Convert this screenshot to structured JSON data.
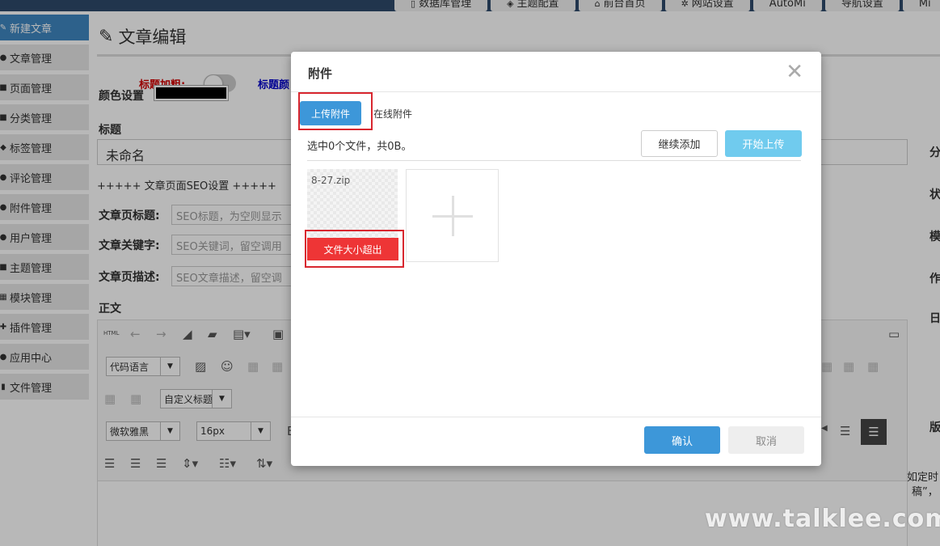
{
  "topnav": [
    {
      "label": "数据库管理",
      "icon": "database-icon"
    },
    {
      "label": "主题配置",
      "icon": "layers-icon"
    },
    {
      "label": "前台首页",
      "icon": "home-icon"
    },
    {
      "label": "网站设置",
      "icon": "gear-icon"
    },
    {
      "label": "AutoMi",
      "icon": ""
    },
    {
      "label": "导航设置",
      "icon": ""
    },
    {
      "label": "Mi",
      "icon": ""
    }
  ],
  "sidebar": {
    "items": [
      {
        "label": "新建文章",
        "icon": "edit-icon",
        "active": true
      },
      {
        "label": "文章管理",
        "icon": "list-icon"
      },
      {
        "label": "页面管理",
        "icon": "page-icon"
      },
      {
        "label": "分类管理",
        "icon": "folder-icon"
      },
      {
        "label": "标签管理",
        "icon": "tag-icon"
      },
      {
        "label": "评论管理",
        "icon": "comment-icon"
      },
      {
        "label": "附件管理",
        "icon": "attachment-icon"
      },
      {
        "label": "用户管理",
        "icon": "user-icon"
      },
      {
        "label": "主题管理",
        "icon": "theme-icon"
      },
      {
        "label": "模块管理",
        "icon": "module-icon"
      },
      {
        "label": "插件管理",
        "icon": "plugin-icon"
      },
      {
        "label": "应用中心",
        "icon": "app-icon"
      },
      {
        "label": "文件管理",
        "icon": "file-icon"
      }
    ]
  },
  "editor_page": {
    "title": "文章编辑",
    "title_bold_label": "标题加粗:",
    "title_color_label": "标题颜",
    "color_setting_label": "颜色设置",
    "title_label": "标题",
    "title_value": "未命名",
    "seo_header": "+++++ 文章页面SEO设置 +++++",
    "seo_title_label": "文章页标题:",
    "seo_title_placeholder": "SEO标题，为空则显示",
    "seo_keywords_label": "文章关键字:",
    "seo_keywords_placeholder": "SEO关键词，留空调用",
    "seo_desc_label": "文章页描述:",
    "seo_desc_placeholder": "SEO文章描述，留空调",
    "body_label": "正文",
    "toolbar": {
      "html_label": "HTML",
      "code_lang": "代码语言",
      "custom_title": "自定义标题",
      "font_family": "微软雅黑",
      "font_size": "16px"
    }
  },
  "right_labels": [
    "分",
    "状",
    "模",
    "作",
    "日",
    "版"
  ],
  "right_note": [
    "如定时",
    "稿”，"
  ],
  "watermark": "www.talklee.com",
  "modal": {
    "title": "附件",
    "close": "✕",
    "tab_upload": "上传附件",
    "tab_online": "在线附件",
    "status": "选中0个文件，共0B。",
    "btn_add": "继续添加",
    "btn_start": "开始上传",
    "file": {
      "name": "8-27.zip",
      "error": "文件大小超出"
    },
    "btn_confirm": "确认",
    "btn_cancel": "取消"
  },
  "colors": {
    "accent": "#3d97d9",
    "sidebar_active": "#3f87c1",
    "error": "#ee3536",
    "highlight": "#d8272f",
    "start_button": "#70cbee"
  }
}
